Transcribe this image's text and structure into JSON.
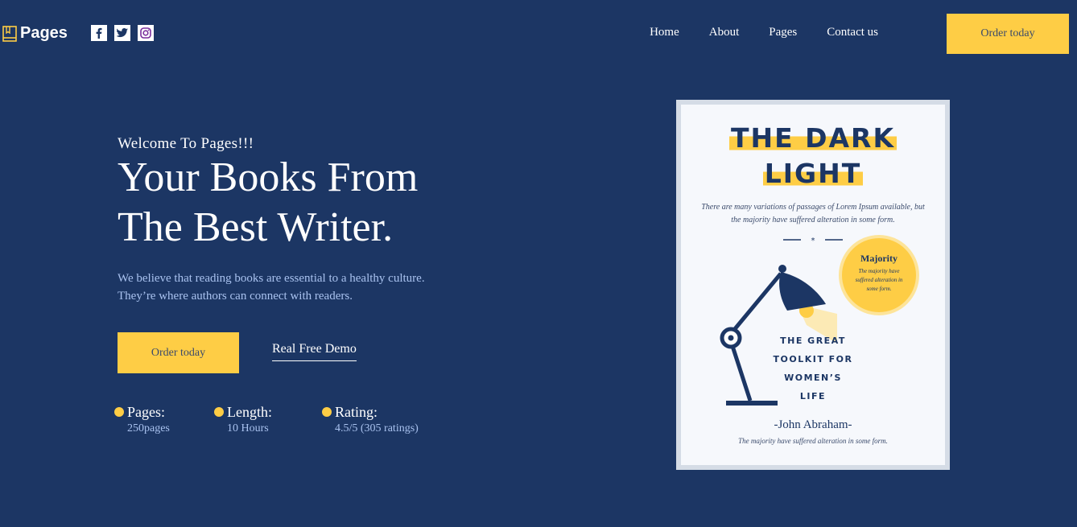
{
  "brand": {
    "name": "Pages",
    "logo_icon": "book-icon"
  },
  "socials": [
    {
      "icon": "facebook-icon",
      "glyph": "f"
    },
    {
      "icon": "twitter-icon"
    },
    {
      "icon": "instagram-icon"
    }
  ],
  "nav": {
    "items": [
      "Home",
      "About",
      "Pages",
      "Contact us"
    ]
  },
  "header": {
    "cta_label": "Order today"
  },
  "hero": {
    "welcome": "Welcome To Pages!!!",
    "headline_line1": "Your Books From",
    "headline_line2": "The Best Writer.",
    "description_line1": "We believe that reading books are essential to a healthy culture.",
    "description_line2": "They’re where authors can connect with readers.",
    "order_label": "Order today",
    "demo_label": "Real Free Demo"
  },
  "stats": [
    {
      "label": "Pages:",
      "value": "250pages"
    },
    {
      "label": "Length:",
      "value": "10 Hours"
    },
    {
      "label": "Rating:",
      "value": "4.5/5 (305 ratings)"
    }
  ],
  "book": {
    "title_line1": "THE DARK",
    "title_line2": "LIGHT",
    "blurb_line1": "There are many variations of passages of Lorem Ipsum available, but",
    "blurb_line2": "the majority have suffered alteration in some form.",
    "badge_title": "Majority",
    "badge_text": "The majority have suffered alteration in some form.",
    "subtitle_lines": [
      "THE GREAT",
      "TOOLKIT FOR",
      "WOMEN’S",
      "LIFE"
    ],
    "author": "-John Abraham-",
    "footer": "The majority have suffered alteration in some form.",
    "illustration_icon": "desk-lamp-icon"
  },
  "colors": {
    "background": "#1c3664",
    "accent": "#fecd45",
    "muted_text": "#a9c2ef",
    "cover": "#f6f8fc"
  }
}
